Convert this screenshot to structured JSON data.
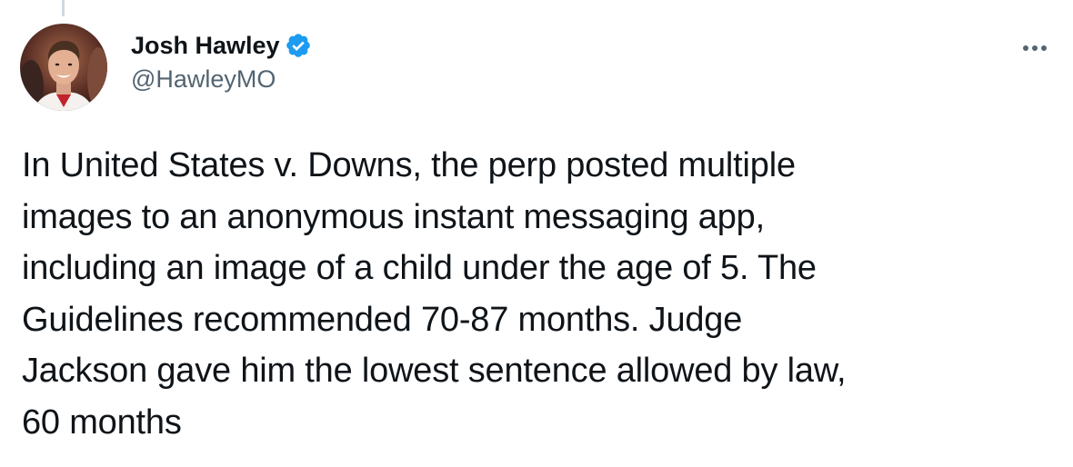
{
  "tweet": {
    "author": {
      "display_name": "Josh Hawley",
      "handle": "@HawleyMO",
      "verified": true,
      "avatar_icon": "profile-photo"
    },
    "text": "In United States v. Downs, the perp posted multiple\nimages to an anonymous instant messaging app,\nincluding an image of a child under the age of 5. The\nGuidelines recommended 70-87 months. Judge\nJackson gave him the lowest sentence allowed by law,\n60 months",
    "more_icon": "more-horizontal-icon"
  },
  "colors": {
    "verified_badge": "#1d9bf0",
    "text_primary": "#0f1419",
    "text_secondary": "#536471",
    "thread_line": "#cfd9de"
  }
}
